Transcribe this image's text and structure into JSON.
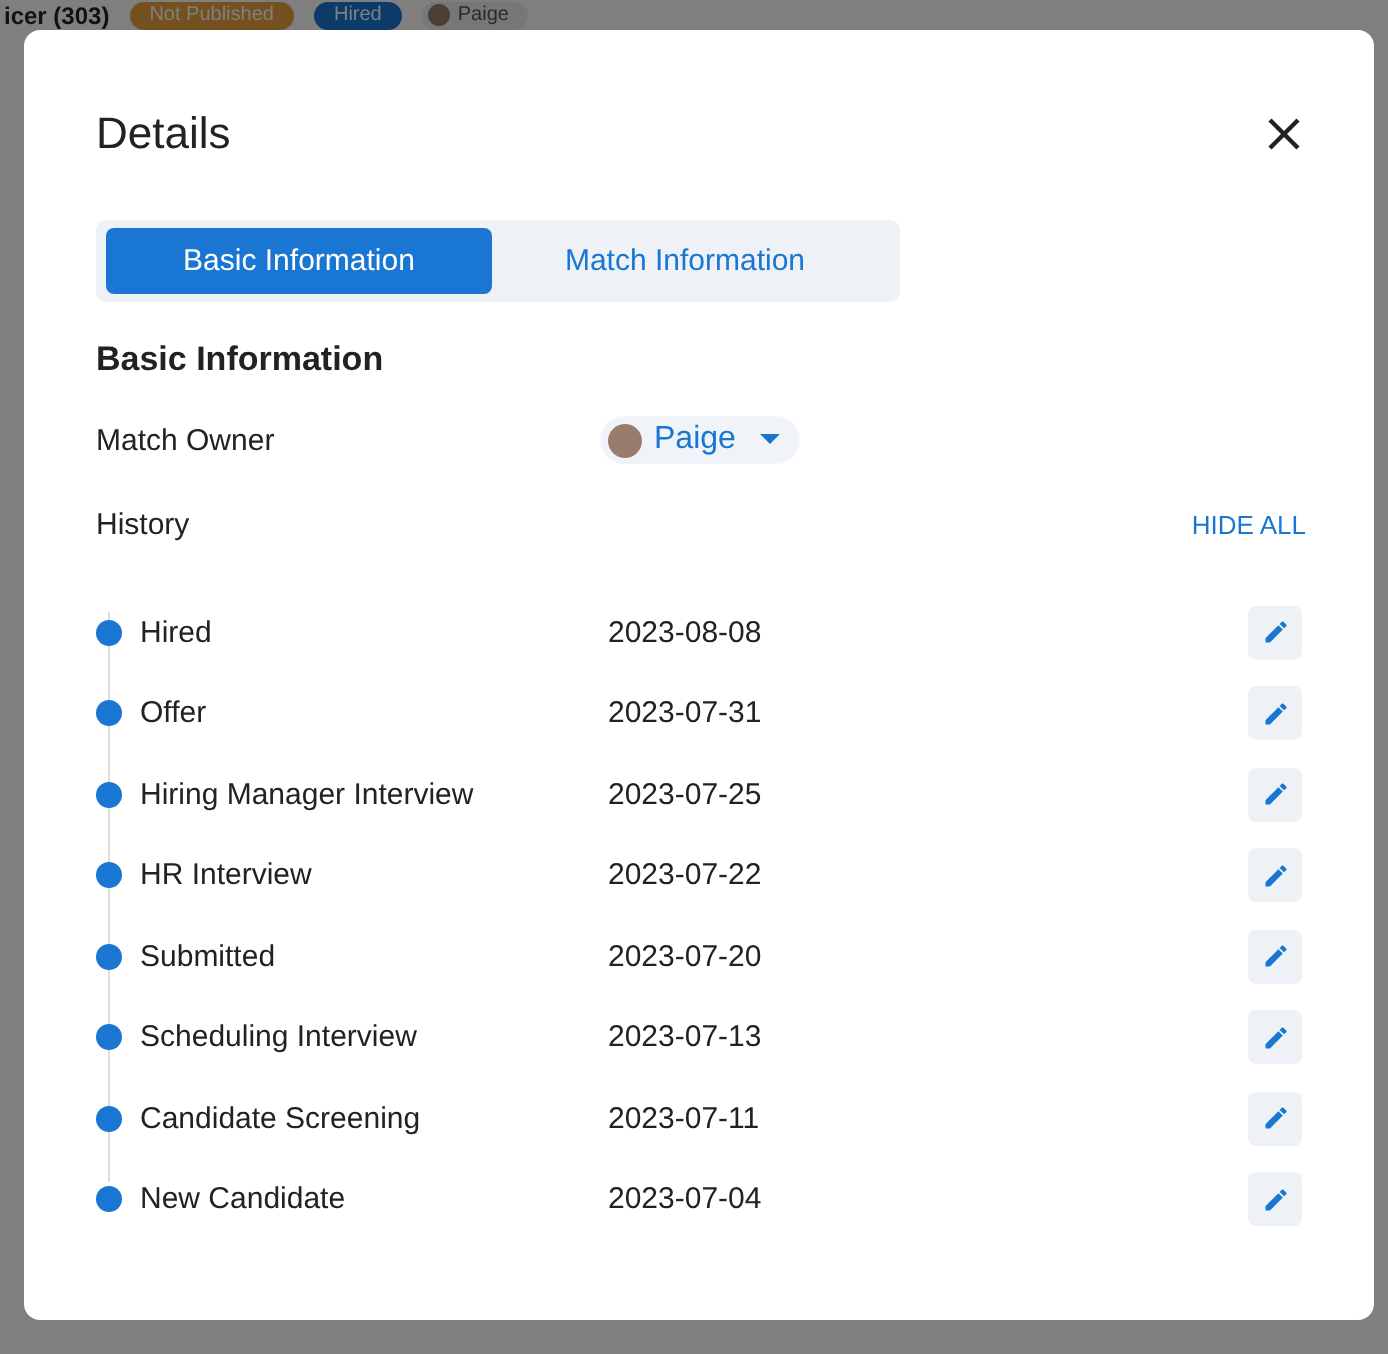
{
  "background": {
    "title": "icer (303)",
    "badges": [
      {
        "label": "Not Published",
        "color": "#74511e"
      },
      {
        "label": "Hired",
        "color": "#0c3b69"
      }
    ],
    "owner": "Paige"
  },
  "dialog": {
    "title": "Details",
    "tabs": [
      {
        "label": "Basic Information",
        "selected": true
      },
      {
        "label": "Match Information",
        "selected": false
      }
    ],
    "section_title": "Basic Information",
    "match_owner": {
      "label": "Match Owner",
      "value": "Paige"
    },
    "history": {
      "label": "History",
      "toggle": "HIDE ALL",
      "items": [
        {
          "stage": "Hired",
          "date": "2023-08-08"
        },
        {
          "stage": "Offer",
          "date": "2023-07-31"
        },
        {
          "stage": "Hiring Manager Interview",
          "date": "2023-07-25"
        },
        {
          "stage": "HR Interview",
          "date": "2023-07-22"
        },
        {
          "stage": "Submitted",
          "date": "2023-07-20"
        },
        {
          "stage": "Scheduling Interview",
          "date": "2023-07-13"
        },
        {
          "stage": "Candidate Screening",
          "date": "2023-07-11"
        },
        {
          "stage": "New Candidate",
          "date": "2023-07-04"
        }
      ]
    }
  }
}
